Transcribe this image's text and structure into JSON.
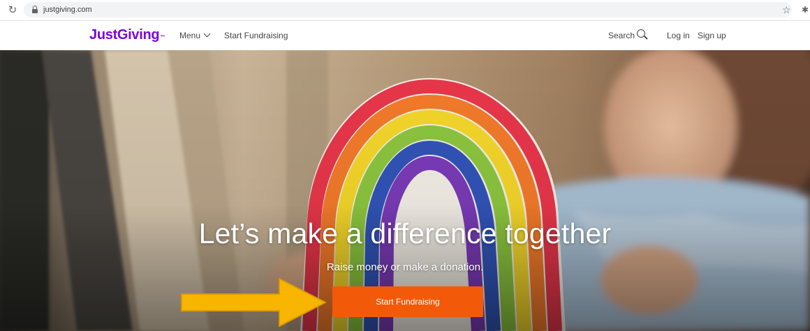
{
  "browser": {
    "url": "justgiving.com",
    "reload_icon": "reload-icon",
    "lock_icon": "lock-icon",
    "bookmark_icon": "star-icon",
    "extensions_icon": "puzzle-icon"
  },
  "header": {
    "logo": "JustGiving",
    "logo_tm": "™",
    "menu_label": "Menu",
    "start_fundraising": "Start Fundraising",
    "search_label": "Search",
    "login": "Log in",
    "signup": "Sign up",
    "brand_color": "#7a04dd"
  },
  "hero": {
    "title": "Let’s make a difference together",
    "subtitle": "Raise money or make a donation.",
    "cta_label": "Start Fundraising",
    "cta_color": "#f25a0a",
    "image": "child holding a hand-drawn rainbow",
    "annotation": "yellow arrow pointing at the call-to-action button",
    "annotation_color": "#f8b500"
  }
}
